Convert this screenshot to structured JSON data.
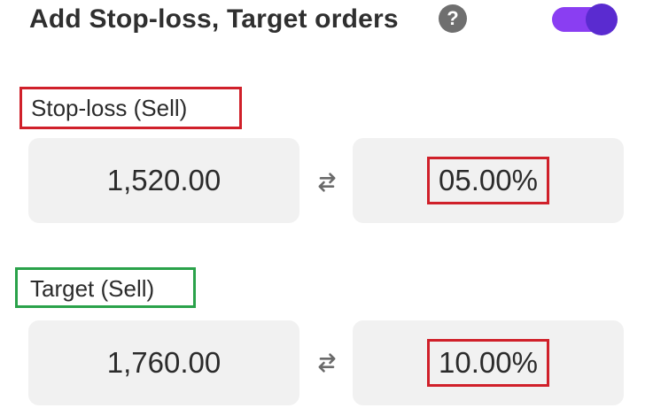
{
  "header": {
    "title": "Add Stop-loss, Target orders",
    "help_icon": "?",
    "toggle_on": true
  },
  "stoploss": {
    "label": "Stop-loss (Sell)",
    "price": "1,520.00",
    "percent": "05.00%"
  },
  "target": {
    "label": "Target (Sell)",
    "price": "1,760.00",
    "percent": "10.00%"
  },
  "icons": {
    "help": "help-icon",
    "swap": "swap-arrows-icon"
  },
  "colors": {
    "toggle_track": "#8a3ef2",
    "toggle_knob": "#5a2bd0",
    "stoploss_highlight": "#d0202a",
    "target_highlight": "#2aa24a",
    "box_background": "#f1f1f1"
  }
}
